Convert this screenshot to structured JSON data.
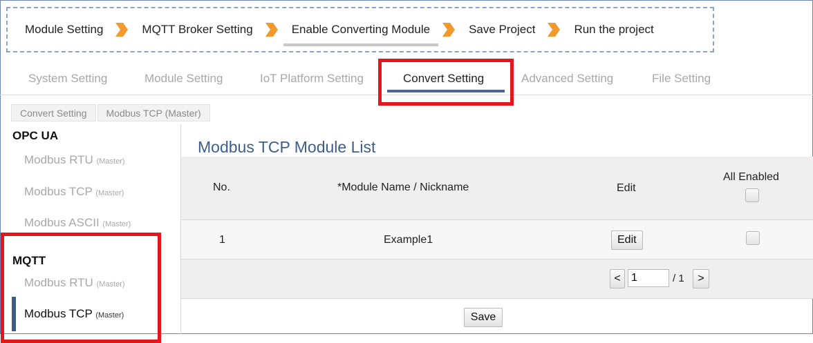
{
  "wizard": {
    "steps": [
      "Module Setting",
      "MQTT Broker Setting",
      "Enable Converting Module",
      "Save Project",
      "Run the project"
    ],
    "active_index": 2,
    "arrow_color": "#f29a2e"
  },
  "tabs": [
    "System Setting",
    "Module Setting",
    "IoT Platform Setting",
    "Convert Setting",
    "Advanced Setting",
    "File Setting"
  ],
  "active_tab": "Convert Setting",
  "breadcrumb": [
    "Convert Setting",
    "Modbus TCP (Master)"
  ],
  "sidebar": {
    "groups": [
      {
        "title": "OPC UA",
        "items": [
          {
            "label": "Modbus RTU",
            "sub": "(Master)"
          },
          {
            "label": "Modbus TCP",
            "sub": "(Master)"
          },
          {
            "label": "Modbus ASCII",
            "sub": "(Master)"
          }
        ]
      },
      {
        "title": "MQTT",
        "items": [
          {
            "label": "Modbus RTU",
            "sub": "(Master)"
          },
          {
            "label": "Modbus TCP",
            "sub": "(Master)"
          }
        ]
      }
    ],
    "active_item": "MQTT / Modbus TCP (Master)"
  },
  "content": {
    "title": "Modbus TCP Module List",
    "columns": [
      "No.",
      "*Module Name / Nickname",
      "Edit",
      "All Enabled"
    ],
    "rows": [
      {
        "no": "1",
        "name": "Example1",
        "edit_label": "Edit",
        "enabled": false
      }
    ],
    "all_enabled": false,
    "pager": {
      "prev": "<",
      "page": "1",
      "total": "/ 1",
      "next": ">"
    },
    "save_label": "Save"
  },
  "colors": {
    "accent_blue": "#3d5e8c",
    "highlight_red": "#e8141c",
    "arrow_orange": "#f29a2e"
  }
}
